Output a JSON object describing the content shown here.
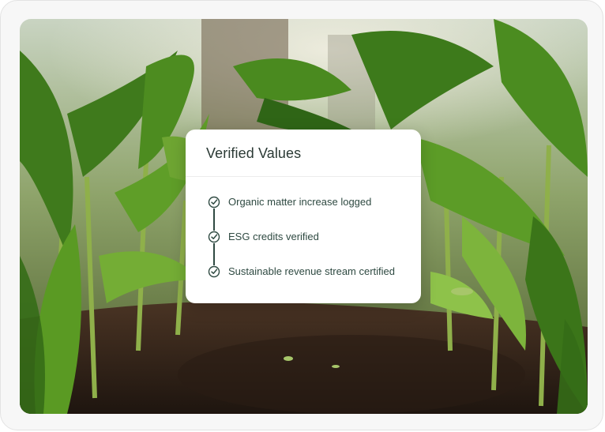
{
  "card": {
    "title": "Verified Values",
    "items": [
      {
        "label": "Organic matter increase logged",
        "icon": "check-circle-icon"
      },
      {
        "label": "ESG credits verified",
        "icon": "check-circle-icon"
      },
      {
        "label": "Sustainable revenue stream certified",
        "icon": "check-circle-icon"
      }
    ]
  },
  "colors": {
    "text_dark": "#2b3a35",
    "accent": "#2f4a42",
    "card_bg": "#ffffff",
    "frame_bg": "#f7f7f7"
  }
}
